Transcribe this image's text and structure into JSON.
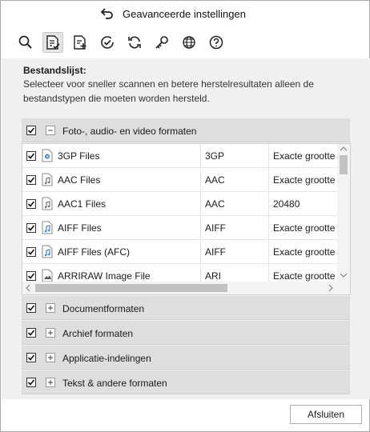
{
  "window": {
    "title": "Geavanceerde instellingen"
  },
  "toolbar": {
    "items": [
      {
        "name": "search-icon",
        "active": false
      },
      {
        "name": "file-list-icon",
        "active": true
      },
      {
        "name": "add-file-icon",
        "active": false
      },
      {
        "name": "check-circle-icon",
        "active": false
      },
      {
        "name": "refresh-icon",
        "active": false
      },
      {
        "name": "key-icon",
        "active": false
      },
      {
        "name": "globe-icon",
        "active": false
      },
      {
        "name": "help-icon",
        "active": false
      }
    ]
  },
  "section": {
    "title": "Bestandslijst:",
    "description": "Selecteer voor sneller scannen en betere herstelresultaten alleen de bestandstypen die moeten worden hersteld."
  },
  "groups": [
    {
      "label": "Foto-, audio- en video formaten",
      "expanded": true,
      "checked": true
    },
    {
      "label": "Documentformaten",
      "expanded": false,
      "checked": true
    },
    {
      "label": "Archief formaten",
      "expanded": false,
      "checked": true
    },
    {
      "label": "Applicatie-indelingen",
      "expanded": false,
      "checked": true
    },
    {
      "label": "Tekst & andere formaten",
      "expanded": false,
      "checked": true
    }
  ],
  "file_rows": [
    {
      "name": "3GP Files",
      "ext": "3GP",
      "size": "Exacte grootte",
      "icon": "video-file-icon",
      "checked": true
    },
    {
      "name": "AAC Files",
      "ext": "AAC",
      "size": "Exacte grootte",
      "icon": "audio-file-icon",
      "checked": true
    },
    {
      "name": "AAC1 Files",
      "ext": "AAC",
      "size": "20480",
      "icon": "audio-file-icon",
      "checked": true
    },
    {
      "name": "AIFF Files",
      "ext": "AIFF",
      "size": "Exacte grootte",
      "icon": "audio-file-icon",
      "checked": true
    },
    {
      "name": "AIFF Files (AFC)",
      "ext": "AIFF",
      "size": "Exacte grootte",
      "icon": "audio-file-icon",
      "checked": true
    },
    {
      "name": "ARRIRAW Image File",
      "ext": "ARI",
      "size": "Exacte grootte",
      "icon": "image-file-icon",
      "checked": true
    }
  ],
  "footer": {
    "close_label": "Afsluiten"
  },
  "colors": {
    "panel_bg": "#f0f0f0",
    "group_bg": "#dedede",
    "accent": "#2a6fdb"
  }
}
